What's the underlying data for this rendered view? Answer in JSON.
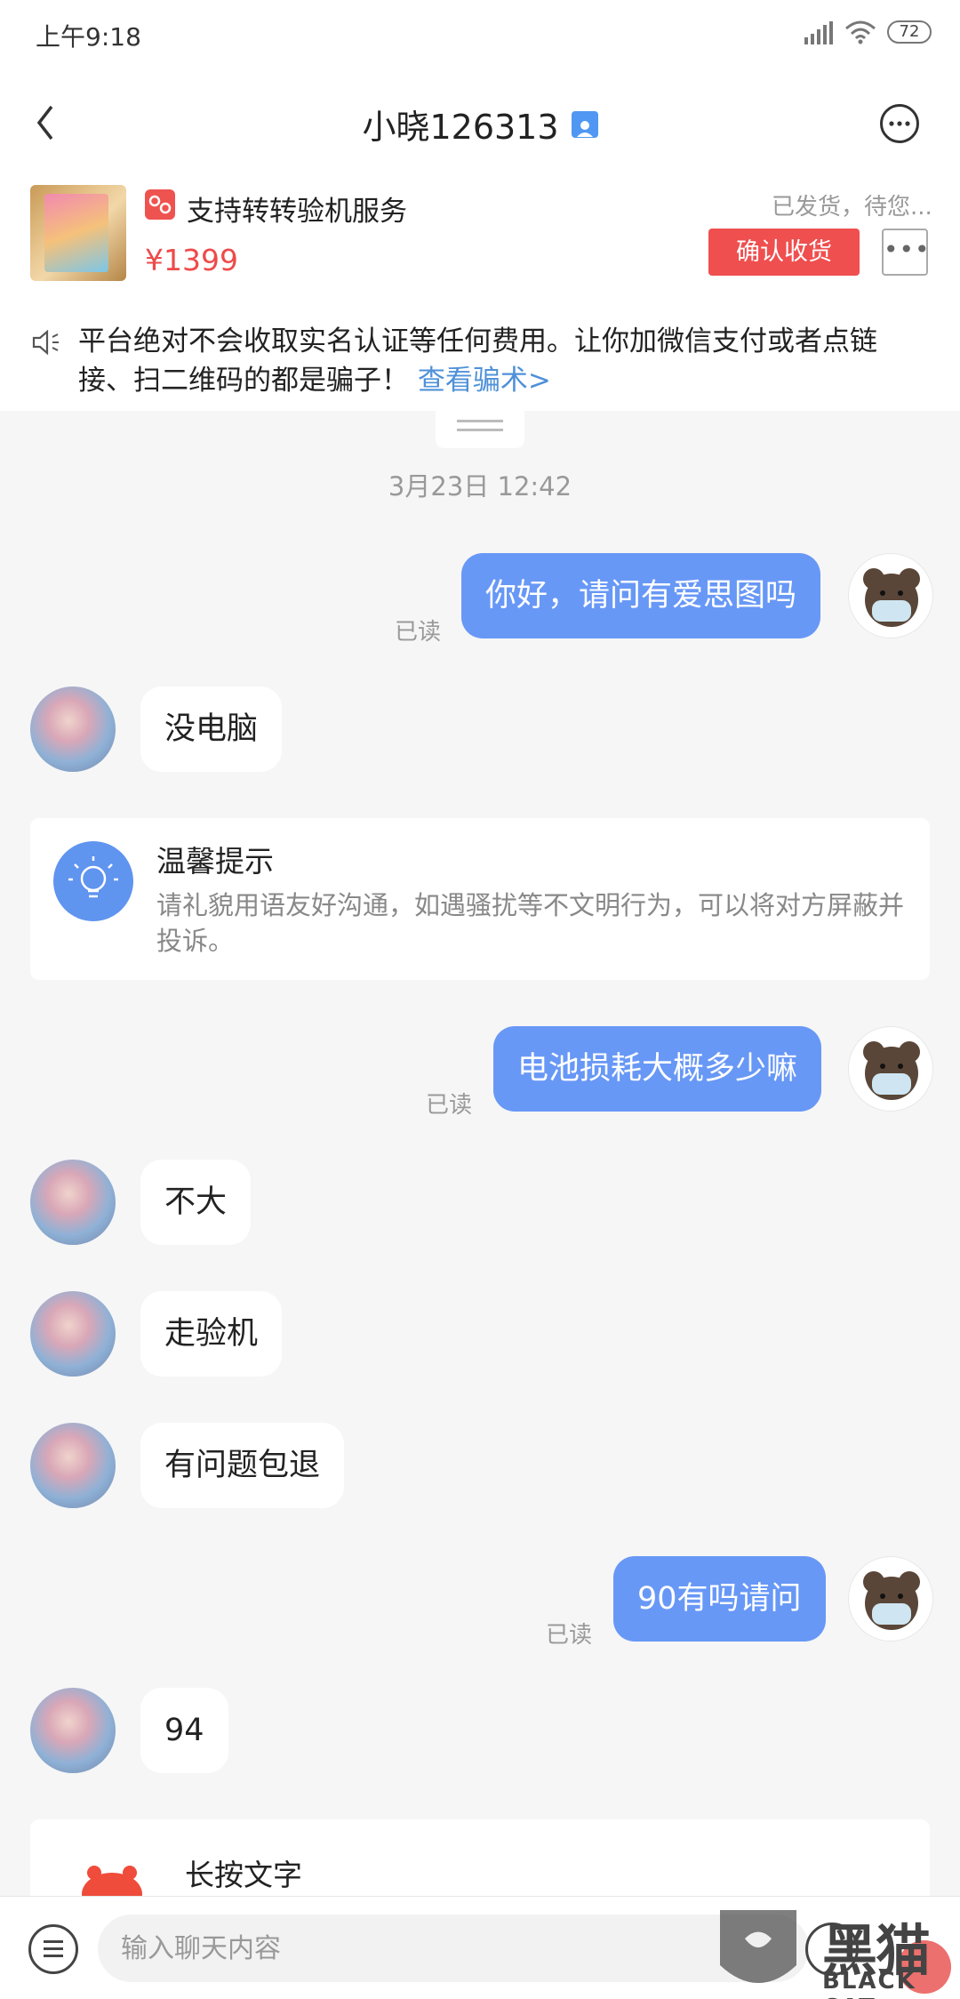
{
  "status_bar": {
    "time": "上午9:18",
    "battery": "72"
  },
  "header": {
    "title": "小晓126313"
  },
  "product": {
    "service_text": "支持转转验机服务",
    "price": "¥1399",
    "status": "已发货，待您...",
    "confirm_label": "确认收货",
    "more_label": "•••"
  },
  "notice": {
    "text": "平台绝对不会收取实名认证等任何费用。让你加微信支付或者点链接、扫二维码的都是骗子！",
    "link": "查看骗术>"
  },
  "chat": {
    "timestamp": "3月23日 12:42",
    "read_label": "已读",
    "messages": [
      {
        "side": "out",
        "text": "你好，请问有爱思图吗"
      },
      {
        "side": "in",
        "text": "没电脑"
      },
      {
        "side": "out",
        "text": "电池损耗大概多少嘛"
      },
      {
        "side": "in",
        "text": "不大"
      },
      {
        "side": "in",
        "text": "走验机"
      },
      {
        "side": "in",
        "text": "有问题包退"
      },
      {
        "side": "out",
        "text": "90有吗请问"
      },
      {
        "side": "in",
        "text": "94"
      }
    ],
    "tip": {
      "title": "温馨提示",
      "text": "请礼貌用语友好沟通，如遇骚扰等不文明行为，可以将对方屏蔽并投诉。"
    },
    "press_card": {
      "title": "长按文字"
    }
  },
  "input": {
    "placeholder": "输入聊天内容"
  },
  "watermark": {
    "text": "黑猫",
    "sub": "BLACK CAT"
  },
  "colors": {
    "accent_blue": "#6898f6",
    "danger_red": "#ef4f4f",
    "link_blue": "#4f91d8"
  }
}
